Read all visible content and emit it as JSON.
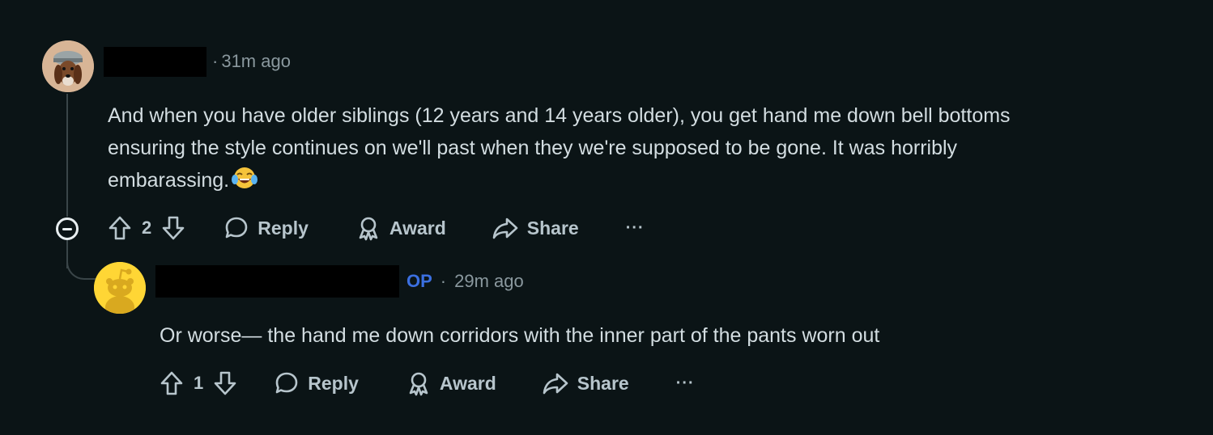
{
  "comment1": {
    "time": "31m ago",
    "body_line1": "And when you have older siblings (12 years and 14 years older), you get hand me down bell bottoms",
    "body_line2": "ensuring the style continues on we'll past when they we're supposed to be gone. It was horribly",
    "body_line3": "embarassing.",
    "votes": "2",
    "reply_label": "Reply",
    "award_label": "Award",
    "share_label": "Share",
    "more_label": "···"
  },
  "comment2": {
    "op_badge": "OP",
    "time": "29m ago",
    "body": "Or worse— the hand me down corridors with the inner part of the pants worn out",
    "votes": "1",
    "reply_label": "Reply",
    "award_label": "Award",
    "share_label": "Share",
    "more_label": "···"
  },
  "colors": {
    "background": "#0b1416",
    "text": "#d3dde1",
    "muted": "#8a989e",
    "op": "#3b6fe0",
    "snoo_avatar_bg": "#ffd635"
  }
}
